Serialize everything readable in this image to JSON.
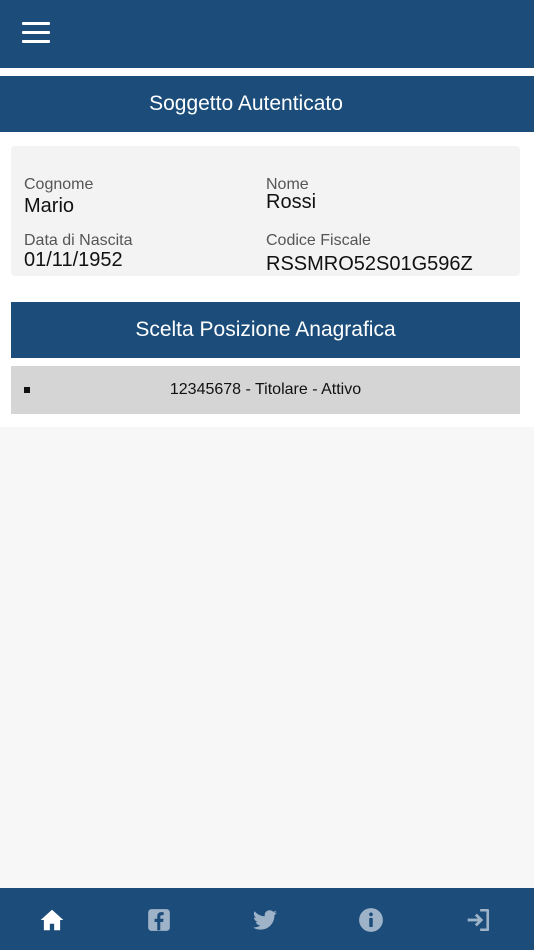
{
  "colors": {
    "primary": "#1b4c7a",
    "page_background": "#f7f7f7",
    "card_background": "#f3f3f3",
    "row_background": "#d5d5d5",
    "active_icon": "#ffffff",
    "inactive_icon": "#9fb3c8"
  },
  "header": {
    "menu_icon": "hamburger-menu-icon"
  },
  "authenticated": {
    "title": "Soggetto Autenticato",
    "fields": {
      "cognome": {
        "label": "Cognome",
        "value": "Mario"
      },
      "nome": {
        "label": "Nome",
        "value": "Rossi"
      },
      "data_nascita": {
        "label": "Data di Nascita",
        "value": "01/11/1952"
      },
      "codice_fiscale": {
        "label": "Codice Fiscale",
        "value": "RSSMRO52S01G596Z"
      }
    }
  },
  "positions": {
    "title": "Scelta Posizione Anagrafica",
    "items": [
      {
        "label": "12345678 - Titolare - Attivo"
      }
    ]
  },
  "bottom_nav": {
    "items": [
      {
        "icon": "home-icon",
        "active": true
      },
      {
        "icon": "facebook-icon",
        "active": false
      },
      {
        "icon": "twitter-icon",
        "active": false
      },
      {
        "icon": "info-icon",
        "active": false
      },
      {
        "icon": "logout-icon",
        "active": false
      }
    ]
  }
}
